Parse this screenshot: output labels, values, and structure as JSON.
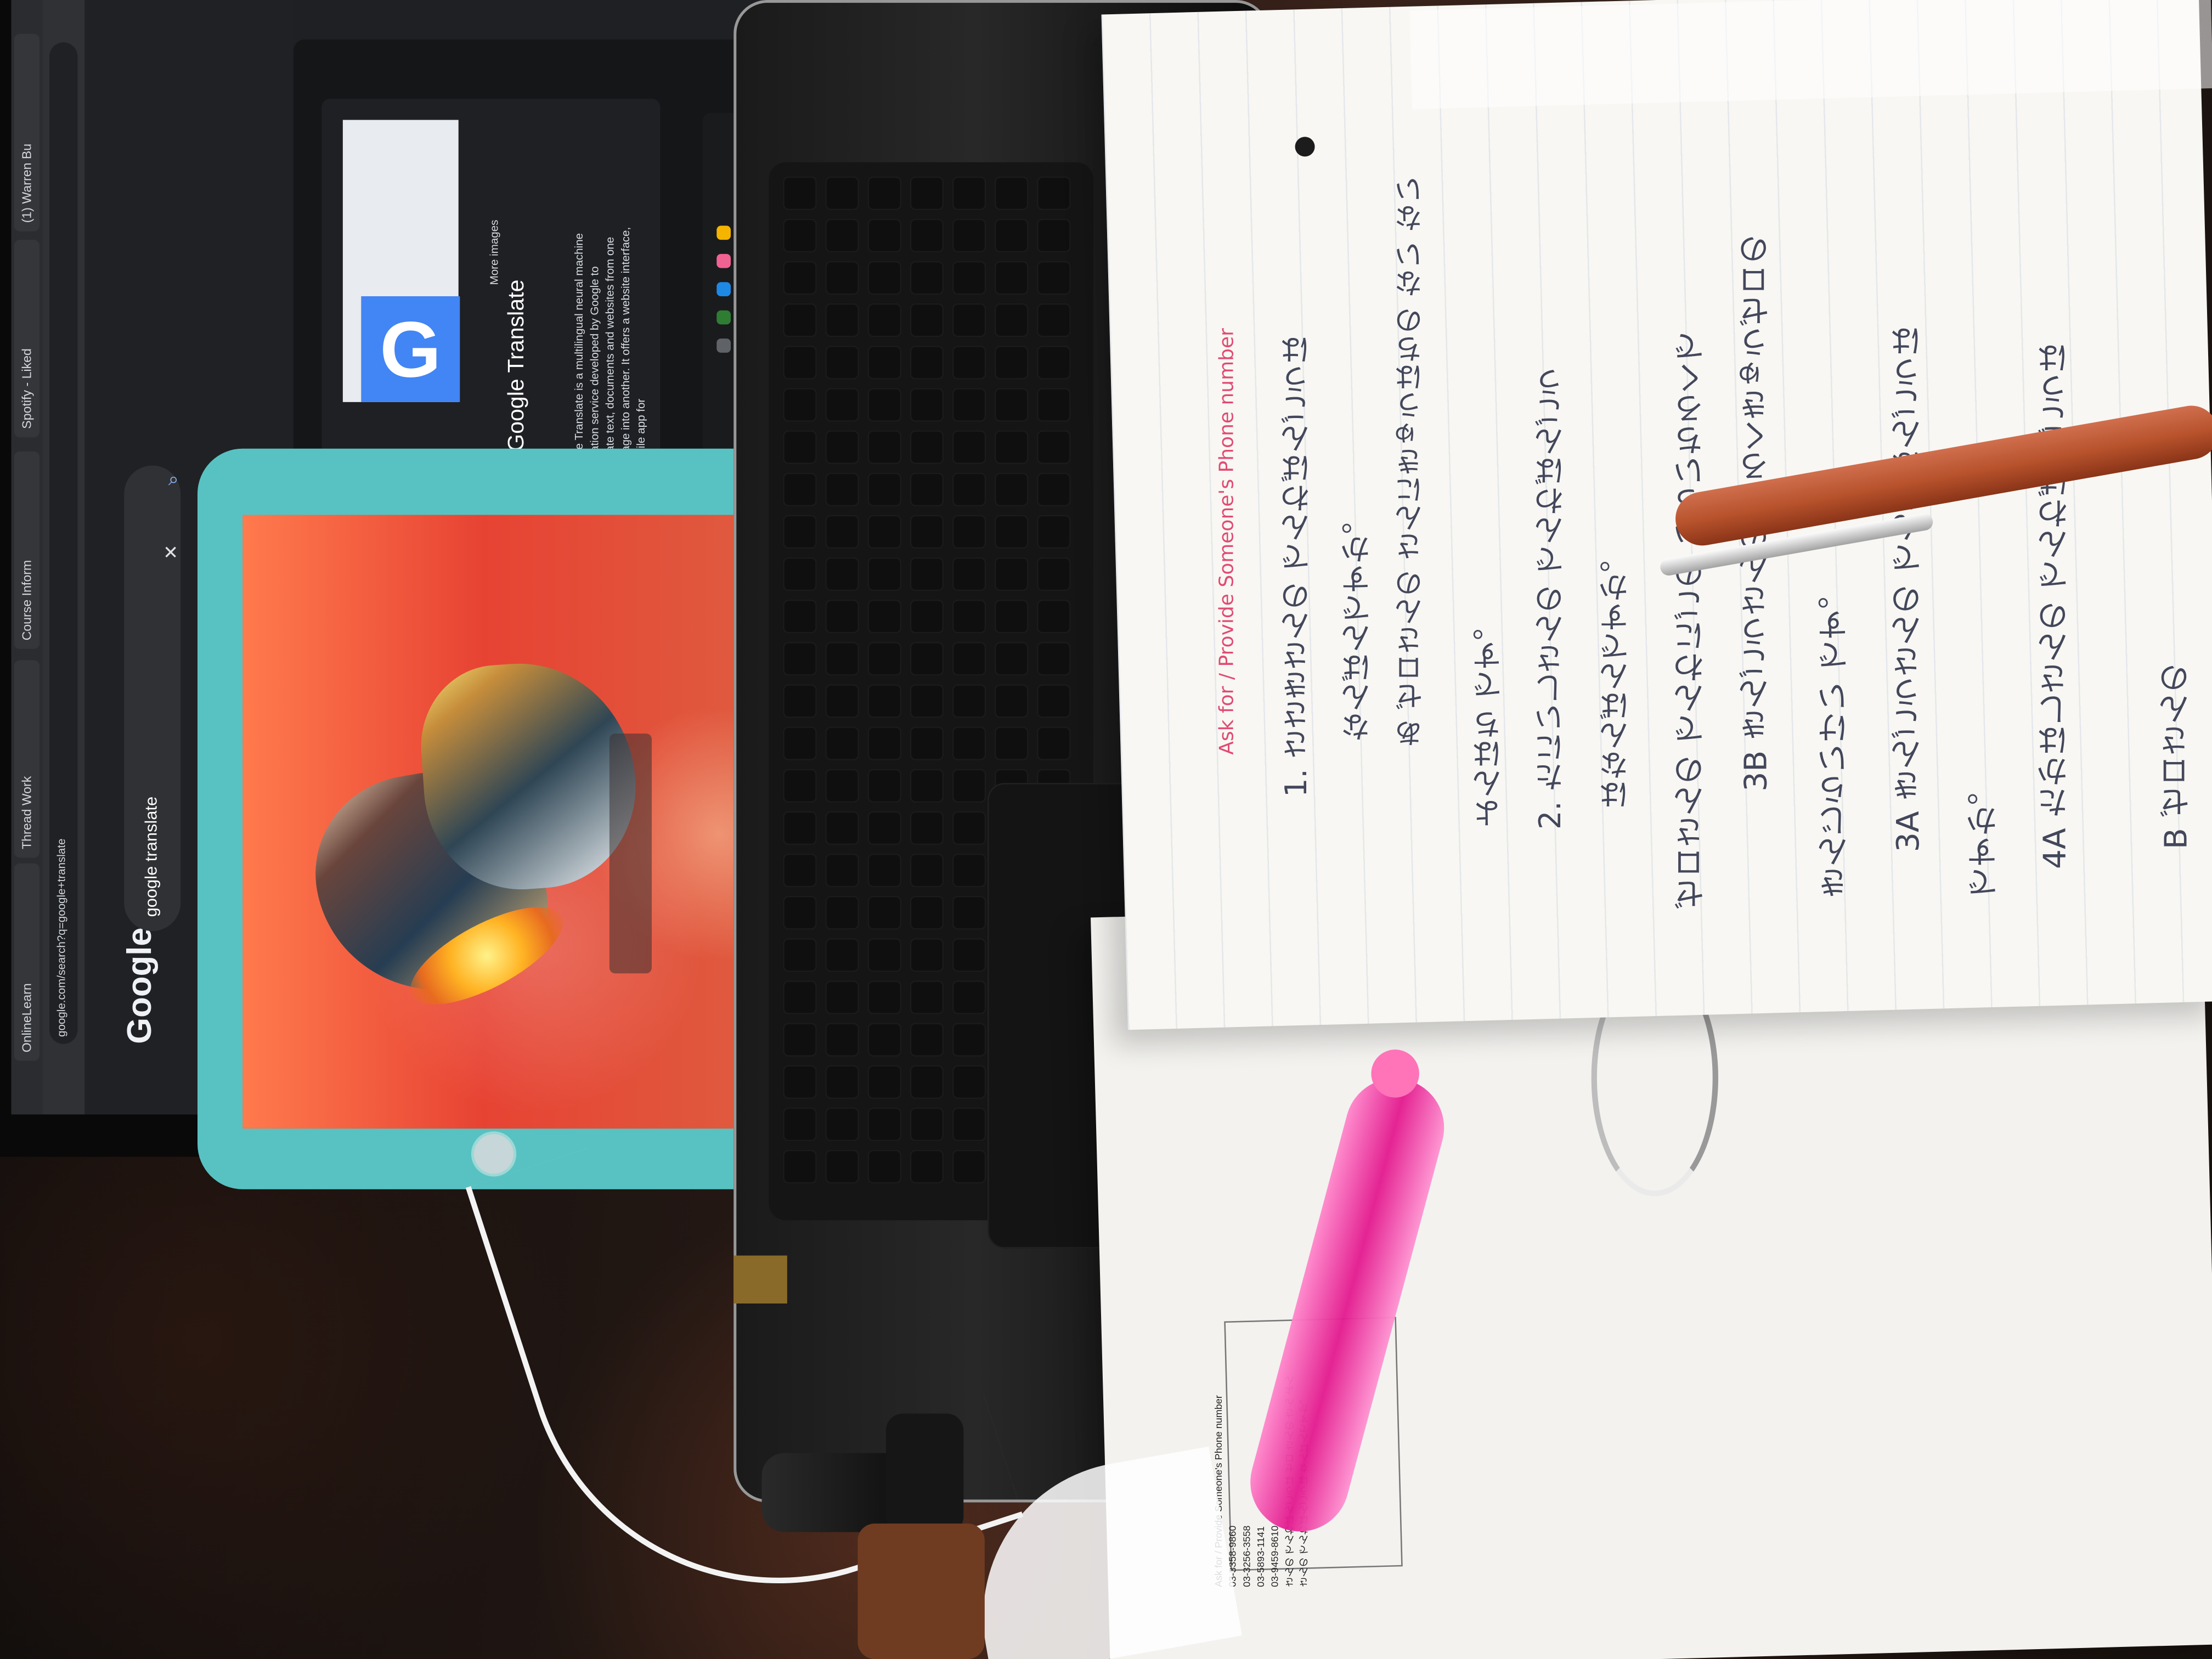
{
  "browser": {
    "tabs": [
      "OnlineLearn",
      "Thread Work",
      "Course Inform",
      "Spotify - Liked",
      "(1) Warren Bu"
    ],
    "search_query": "google translate",
    "address_text": "google.com/search?q=google+translate",
    "google_logo": "Google"
  },
  "knowledge_panel": {
    "title": "Google Translate",
    "more_images": "More images",
    "description": "Google Translate is a multilingual neural machine translation service developed by Google to translate text, documents and websites from one language into another. It offers a website interface, a mobile app for"
  },
  "notebook": {
    "title": "Ask for / Provide Someone's Phone number",
    "lines": [
      "1. ささきさんの でんわばんごうは",
      "なんばんですか。",
      "あ ゼロさんの さんにきゅうはちの ない ない",
      "よんはち です。",
      "2. たにいしさんの でんわばんごう",
      "はなんばんですか。",
      "ゼロさんの でんわにごの いちいちろくで",
      "3B きんごうさんの ごろくきゅうゼロの",
      "きんじらいけい です。",
      "3A きんごうさんの でんわばんごうは",
      "ですか。",
      "4A たかはしさんの でんわばんごうは",
      "B ゼロさんの"
    ]
  },
  "workbook": {
    "lines": "Ask for / Provide Someone's Phone number\n03-3358-9860\n03-3256-3558\n03-5893-1141\n03-9459-8610\nさんの でんわばんごうは ゼロ さんの さん よん\nさんの でんわばんごうは なんばんですか。"
  }
}
